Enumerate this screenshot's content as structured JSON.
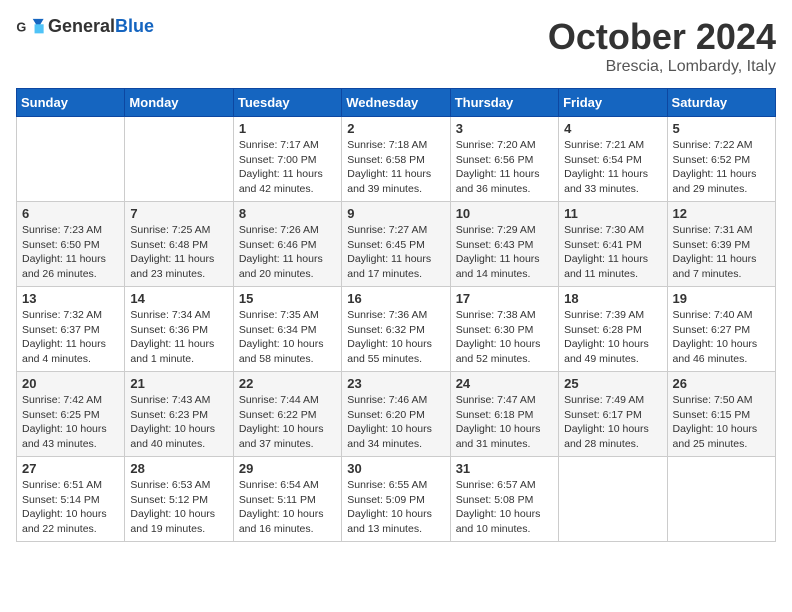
{
  "header": {
    "logo_general": "General",
    "logo_blue": "Blue",
    "month": "October 2024",
    "location": "Brescia, Lombardy, Italy"
  },
  "days_of_week": [
    "Sunday",
    "Monday",
    "Tuesday",
    "Wednesday",
    "Thursday",
    "Friday",
    "Saturday"
  ],
  "weeks": [
    [
      {
        "day": "",
        "info": ""
      },
      {
        "day": "",
        "info": ""
      },
      {
        "day": "1",
        "info": "Sunrise: 7:17 AM\nSunset: 7:00 PM\nDaylight: 11 hours and 42 minutes."
      },
      {
        "day": "2",
        "info": "Sunrise: 7:18 AM\nSunset: 6:58 PM\nDaylight: 11 hours and 39 minutes."
      },
      {
        "day": "3",
        "info": "Sunrise: 7:20 AM\nSunset: 6:56 PM\nDaylight: 11 hours and 36 minutes."
      },
      {
        "day": "4",
        "info": "Sunrise: 7:21 AM\nSunset: 6:54 PM\nDaylight: 11 hours and 33 minutes."
      },
      {
        "day": "5",
        "info": "Sunrise: 7:22 AM\nSunset: 6:52 PM\nDaylight: 11 hours and 29 minutes."
      }
    ],
    [
      {
        "day": "6",
        "info": "Sunrise: 7:23 AM\nSunset: 6:50 PM\nDaylight: 11 hours and 26 minutes."
      },
      {
        "day": "7",
        "info": "Sunrise: 7:25 AM\nSunset: 6:48 PM\nDaylight: 11 hours and 23 minutes."
      },
      {
        "day": "8",
        "info": "Sunrise: 7:26 AM\nSunset: 6:46 PM\nDaylight: 11 hours and 20 minutes."
      },
      {
        "day": "9",
        "info": "Sunrise: 7:27 AM\nSunset: 6:45 PM\nDaylight: 11 hours and 17 minutes."
      },
      {
        "day": "10",
        "info": "Sunrise: 7:29 AM\nSunset: 6:43 PM\nDaylight: 11 hours and 14 minutes."
      },
      {
        "day": "11",
        "info": "Sunrise: 7:30 AM\nSunset: 6:41 PM\nDaylight: 11 hours and 11 minutes."
      },
      {
        "day": "12",
        "info": "Sunrise: 7:31 AM\nSunset: 6:39 PM\nDaylight: 11 hours and 7 minutes."
      }
    ],
    [
      {
        "day": "13",
        "info": "Sunrise: 7:32 AM\nSunset: 6:37 PM\nDaylight: 11 hours and 4 minutes."
      },
      {
        "day": "14",
        "info": "Sunrise: 7:34 AM\nSunset: 6:36 PM\nDaylight: 11 hours and 1 minute."
      },
      {
        "day": "15",
        "info": "Sunrise: 7:35 AM\nSunset: 6:34 PM\nDaylight: 10 hours and 58 minutes."
      },
      {
        "day": "16",
        "info": "Sunrise: 7:36 AM\nSunset: 6:32 PM\nDaylight: 10 hours and 55 minutes."
      },
      {
        "day": "17",
        "info": "Sunrise: 7:38 AM\nSunset: 6:30 PM\nDaylight: 10 hours and 52 minutes."
      },
      {
        "day": "18",
        "info": "Sunrise: 7:39 AM\nSunset: 6:28 PM\nDaylight: 10 hours and 49 minutes."
      },
      {
        "day": "19",
        "info": "Sunrise: 7:40 AM\nSunset: 6:27 PM\nDaylight: 10 hours and 46 minutes."
      }
    ],
    [
      {
        "day": "20",
        "info": "Sunrise: 7:42 AM\nSunset: 6:25 PM\nDaylight: 10 hours and 43 minutes."
      },
      {
        "day": "21",
        "info": "Sunrise: 7:43 AM\nSunset: 6:23 PM\nDaylight: 10 hours and 40 minutes."
      },
      {
        "day": "22",
        "info": "Sunrise: 7:44 AM\nSunset: 6:22 PM\nDaylight: 10 hours and 37 minutes."
      },
      {
        "day": "23",
        "info": "Sunrise: 7:46 AM\nSunset: 6:20 PM\nDaylight: 10 hours and 34 minutes."
      },
      {
        "day": "24",
        "info": "Sunrise: 7:47 AM\nSunset: 6:18 PM\nDaylight: 10 hours and 31 minutes."
      },
      {
        "day": "25",
        "info": "Sunrise: 7:49 AM\nSunset: 6:17 PM\nDaylight: 10 hours and 28 minutes."
      },
      {
        "day": "26",
        "info": "Sunrise: 7:50 AM\nSunset: 6:15 PM\nDaylight: 10 hours and 25 minutes."
      }
    ],
    [
      {
        "day": "27",
        "info": "Sunrise: 6:51 AM\nSunset: 5:14 PM\nDaylight: 10 hours and 22 minutes."
      },
      {
        "day": "28",
        "info": "Sunrise: 6:53 AM\nSunset: 5:12 PM\nDaylight: 10 hours and 19 minutes."
      },
      {
        "day": "29",
        "info": "Sunrise: 6:54 AM\nSunset: 5:11 PM\nDaylight: 10 hours and 16 minutes."
      },
      {
        "day": "30",
        "info": "Sunrise: 6:55 AM\nSunset: 5:09 PM\nDaylight: 10 hours and 13 minutes."
      },
      {
        "day": "31",
        "info": "Sunrise: 6:57 AM\nSunset: 5:08 PM\nDaylight: 10 hours and 10 minutes."
      },
      {
        "day": "",
        "info": ""
      },
      {
        "day": "",
        "info": ""
      }
    ]
  ]
}
